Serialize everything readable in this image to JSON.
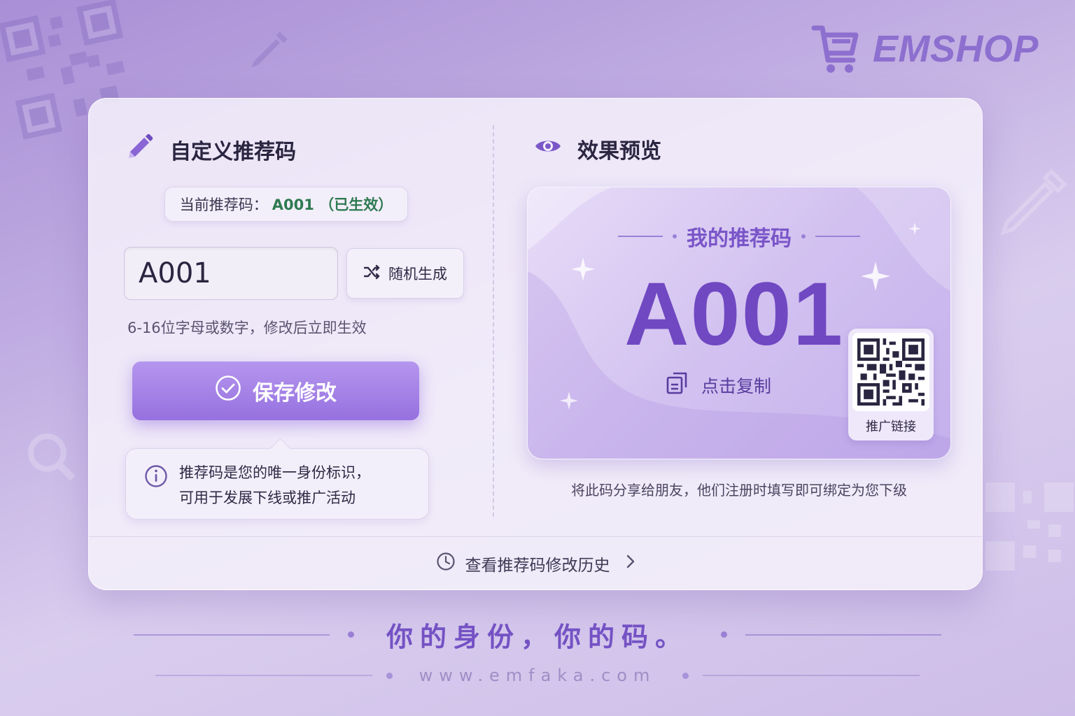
{
  "brand": {
    "name": "EMSHOP",
    "color": "#8d6fcf"
  },
  "left_panel": {
    "title": "自定义推荐码",
    "current_code_label": "当前推荐码：",
    "current_code_value": "A001 （已生效）",
    "input_value": "A001",
    "random_button_label": "随机生成",
    "hint": "6-16位字母或数字，修改后立即生效",
    "save_button_label": "保存修改",
    "tip_line1": "推荐码是您的唯一身份标识，",
    "tip_line2": "可用于发展下线或推广活动"
  },
  "right_panel": {
    "title": "效果预览",
    "card_title": "我的推荐码",
    "card_code": "A001",
    "copy_label": "点击复制",
    "qr_label": "推广链接",
    "caption": "将此码分享给朋友，他们注册时填写即可绑定为您下级"
  },
  "history_link": "查看推荐码修改历史",
  "footer": {
    "slogan": "你的身份，你的码。",
    "url": "www.emfaka.com"
  },
  "colors": {
    "accent": "#9671e0",
    "active_status": "#2f7a52",
    "code_purple": "#7048c2"
  }
}
